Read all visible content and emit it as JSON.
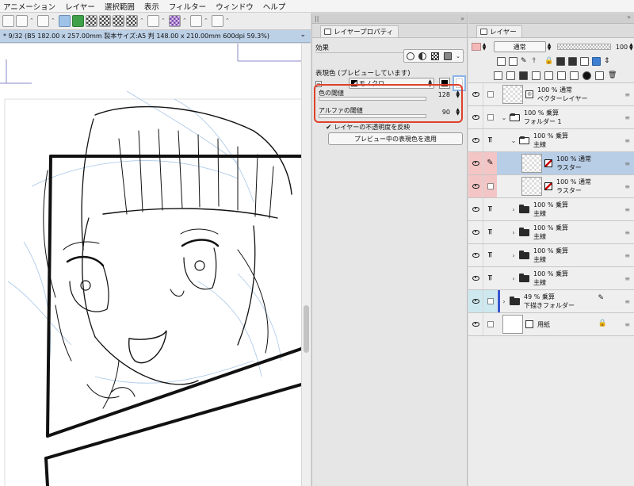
{
  "menu": [
    "アニメーション",
    "レイヤー",
    "選択範囲",
    "表示",
    "フィルター",
    "ウィンドウ",
    "ヘルプ"
  ],
  "file_info": "* 9/32 (B5 182.00 x 257.00mm 製本サイズ:A5 判 148.00 x 210.00mm 600dpi 59.3%)",
  "property_panel": {
    "tab_label": "レイヤープロパティ",
    "effects_label": "効果",
    "expression_label": "表現色 (プレビューしています)",
    "expression_value": "モノクロ",
    "color_threshold_label": "色の閾値",
    "color_threshold_value": "128",
    "alpha_threshold_label": "アルファの閾値",
    "alpha_threshold_value": "90",
    "opacity_checkbox_label": "レイヤーの不透明度を反映",
    "apply_button": "プレビュー中の表現色を適用"
  },
  "layer_panel": {
    "tab_label": "レイヤー",
    "blend_mode": "通常",
    "opacity": "100",
    "layers": [
      {
        "mode": "100 % 通常",
        "name": "ベクターレイヤー",
        "indent": 0,
        "kind": "vector",
        "folder": false
      },
      {
        "mode": "100 % 乗算",
        "name": "フォルダー 1",
        "indent": 0,
        "kind": "folder",
        "folder": true,
        "open": true
      },
      {
        "mode": "100 % 乗算",
        "name": "主線",
        "indent": 1,
        "kind": "folder",
        "folder": true,
        "open": true
      },
      {
        "mode": "100 % 通常",
        "name": "ラスター",
        "indent": 2,
        "kind": "raster",
        "folder": false,
        "selected": true
      },
      {
        "mode": "100 % 通常",
        "name": "ラスター",
        "indent": 2,
        "kind": "raster",
        "folder": false
      },
      {
        "mode": "100 % 乗算",
        "name": "主線",
        "indent": 1,
        "kind": "folder",
        "folder": true,
        "open": false
      },
      {
        "mode": "100 % 乗算",
        "name": "主線",
        "indent": 1,
        "kind": "folder",
        "folder": true,
        "open": false
      },
      {
        "mode": "100 % 乗算",
        "name": "主線",
        "indent": 1,
        "kind": "folder",
        "folder": true,
        "open": false
      },
      {
        "mode": "100 % 乗算",
        "name": "主線",
        "indent": 1,
        "kind": "folder",
        "folder": true,
        "open": false
      },
      {
        "mode": "49 % 乗算",
        "name": "下描きフォルダー",
        "indent": 0,
        "kind": "folder",
        "folder": true,
        "open": false
      },
      {
        "mode": "",
        "name": "用紙",
        "indent": 0,
        "kind": "paper",
        "folder": false
      }
    ]
  },
  "colors": {
    "highlight_box": "#e0402a",
    "selected_layer": "#b8cde6",
    "editing_column": "#f3c5c5"
  }
}
